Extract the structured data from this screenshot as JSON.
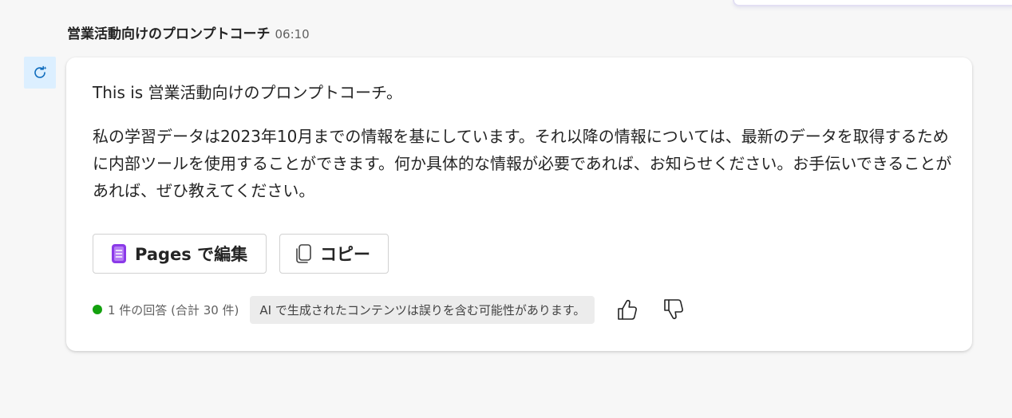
{
  "header": {
    "bot_name": "営業活動向けのプロンプトコーチ",
    "timestamp": "06:10"
  },
  "avatar": {
    "icon": "copilot-refresh-icon",
    "background": "#dcefff",
    "icon_color": "#0f6cbd"
  },
  "message": {
    "line1": "This is 営業活動向けのプロンプトコーチ。",
    "paragraph": "私の学習データは2023年10月までの情報を基にしています。それ以降の情報については、最新のデータを取得するために内部ツールを使用することができます。何か具体的な情報が必要であれば、お知らせください。お手伝いできることがあれば、ぜひ教えてください。"
  },
  "actions": {
    "pages_label": "Pages で編集",
    "pages_icon": "pages-icon",
    "pages_icon_color": "#8b3ae8",
    "copy_label": "コピー",
    "copy_icon": "copy-icon"
  },
  "footer": {
    "status_color": "#13a10e",
    "reply_count": "1 件の回答 (合計 30 件)",
    "disclaimer": "AI で生成されたコンテンツは誤りを含む可能性があります。",
    "like_icon": "thumbs-up-icon",
    "dislike_icon": "thumbs-down-icon"
  }
}
